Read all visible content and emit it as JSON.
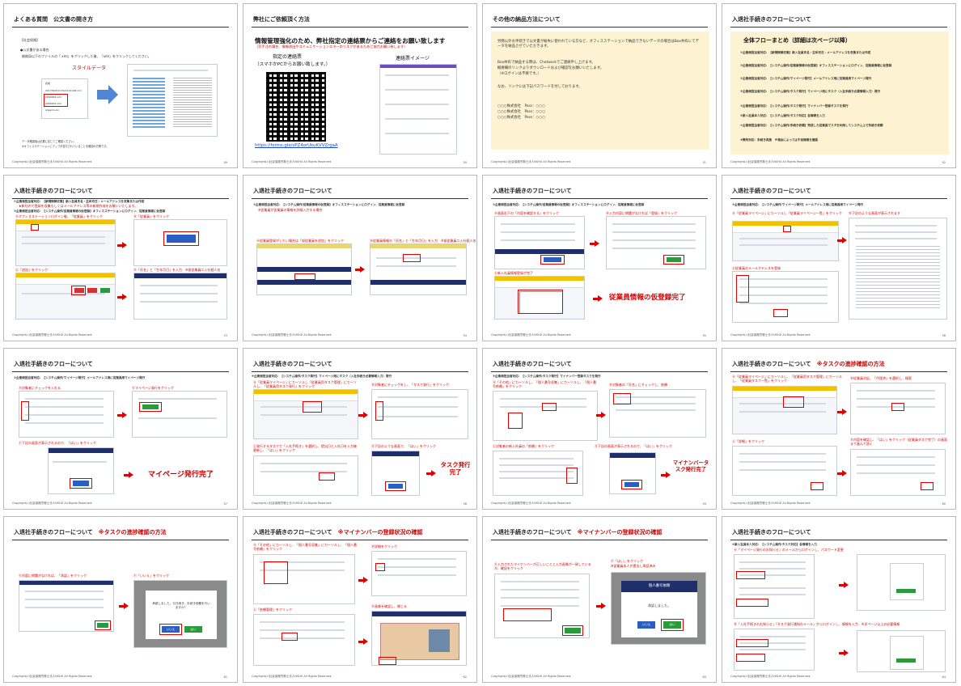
{
  "footer": "Copyright(c)社会保険労務士法人NSHU All Rights Reserved.",
  "slides": [
    {
      "title": "よくある質問　公文書の開き方",
      "num": "49"
    },
    {
      "title": "弊社にご依頼頂く方法",
      "num": "50"
    },
    {
      "title": "その他の納品方法について",
      "num": "51"
    },
    {
      "title": "入退社手続きのフローについて",
      "num": "52"
    },
    {
      "title": "入退社手続きのフローについて",
      "num": "53"
    },
    {
      "title": "入退社手続きのフローについて",
      "num": "54"
    },
    {
      "title": "入退社手続きのフローについて",
      "num": "55"
    },
    {
      "title": "入退社手続きのフローについて",
      "num": "56"
    },
    {
      "title": "入退社手続きのフローについて",
      "num": "57"
    },
    {
      "title": "入退社手続きのフローについて",
      "num": "58"
    },
    {
      "title": "入退社手続きのフローについて",
      "num": "59"
    },
    {
      "title": "入退社手続きのフローについて",
      "title_red": "※タスクの進捗確認の方法",
      "num": "60"
    },
    {
      "title": "入退社手続きのフローについて",
      "title_red": "※タスクの進捗確認の方法",
      "num": "61"
    },
    {
      "title": "入退社手続きのフローについて",
      "title_red": "※マイナンバーの登録状況の確認",
      "num": "62"
    },
    {
      "title": "入退社手続きのフローについて",
      "title_red": "※マイナンバーの登録状況の確認",
      "num": "63"
    },
    {
      "title": "入退社手続きのフローについて",
      "num": "64"
    }
  ],
  "s49": {
    "case": "【社会保険】",
    "bullet": "●公文書がある場合",
    "instr": "総務局以下のファイルの「.xml」をクリックした後、「xml」をクリックしてください。",
    "style_label": "スタイルデータ",
    "files": [
      "名前",
      "20170905111522112148.xml",
      "2064000.xml",
      "2064002.xml",
      "shgams.xsl"
    ],
    "note1": "データ確認後は必要に応じてご確認ください。",
    "note2": "※オフィスステーションにアップが並行されていることを確認の方策です。"
  },
  "s50": {
    "head": "情報管理強化のため、弊社指定の連絡票からご連絡をお願い致します",
    "sub": "（売手注の場合、情報流出やコミュニケーションエラーのリスクがあるためご協力お願い致します）",
    "form_label": "指定の連絡票",
    "form_note": "（スマホかPCからお願い致します。）",
    "image_label": "連絡票イメージ",
    "url": "https://forms.gle/sPZ4orUkuKVVZrgaA"
  },
  "s51": {
    "p1": "労務以外お手続きで公文書が紛失に使われている方など、オフィスステーションで納品できないデータの場合はBox共有にてデータを納品させていただきます。",
    "p2": "Box共有で納品する際は、Chatworkでご連絡申し上げます。",
    "p3": "概要欄のリンクよりダウンロードおよび確認をお願いいたします。",
    "p4": "（※ログインは不要です。）",
    "p5": "なお、リンクには下記パスワードを付しております。",
    "pw": [
      "○○○株式会社　Pass：○○○",
      "○○○株式会社　Pass：○○○",
      "○○○株式会社　Pass：○○○"
    ]
  },
  "s52": {
    "heading": "全体フローまとめ（詳細は次ページ以降）",
    "steps": [
      "①企業側担当者対応：【新規情報収集】新入社員氏名・生年月日・メールアドレスを収集または作成",
      "②企業側担当者対応：【システム操作/従業員情報の仮登録】オフィスステーションにログイン、従業員情報に仮登録",
      "③企業側担当者対応：【システム操作/マイページ発行】メールアドレス用に従業員用マイページ発行",
      "④企業側担当者対応：【システム操作/タスク発行】マイページ用にタスク（入社手続き必要情報入力）発行",
      "⑤企業側担当者対応：【システム操作/タスク発行】マイナンバー登録タスクを発行",
      "⑥新入社員本人対応：【システム操作/タスク対応】各情報を入力",
      "⑦企業側担当者対応：【システム操作/手続き依頼】完成した従業員マスタを利用してシステム上で手続き依頼",
      "⑧弊所対応：手続き実施　※場合によっては不足情報を確認"
    ]
  },
  "s53": {
    "l1": "①企業側担当者対応：【新規情報収集】新入社員氏名・生年月日・メールアドレスを収集または作成",
    "l2": "★新社内で登録を収集もしくはメールアドレス等の新規作成をお願いいたします。",
    "l3": "②企業側担当者対応：【システム操作/従業員情報の仮登録】オフィスステーションにログイン、従業員情報に仮登録",
    "a": "Ⓐオフィスステーションログイン後、「従業員」をクリック",
    "b": "Ⓑ「従業員」をクリック",
    "c": "Ⓒ「追加」をクリック",
    "d": "Ⓓ「氏名」と「生年月日」を入力　※仮従業員二入社個人名"
  },
  "s54": {
    "l1": "②企業側担当者対応：【システム操作/従業員情報の仮登録】オフィスステーションにログイン、従業員情報に仮登録",
    "l2": "※従業員が従業員の情報を詳細入力する場合",
    "a": "Ⓐ従業員登録がしたい場合は「仮従業員を追加」をクリック",
    "b": "Ⓑ従業員情報の「氏名」と「生年月日」を入力　※仮従業員二入社個人名"
  },
  "s55": {
    "l1": "②企業側担当者対応：【システム操作/従業員情報の仮登録】オフィスステーションにログイン、従業員情報に仮登録",
    "a": "Ⓐ画面右下の「内容を確認する」をクリック",
    "b": "Ⓑ入力内容に問題がなければ「登録」をクリック",
    "c": "Ⓒ新入社員情報登録が完了",
    "done": "従業員情報の仮登録完了"
  },
  "s56": {
    "l1": "③企業側担当者対応：【システム操作/マイページ発行】メールアドレス用に従業員用マイページ発行",
    "a": "Ⓐ「従業員マイページ」にカーソルし「従業員マイページ一覧」をクリック",
    "b": "Ⓑ下記のような画面が表示されます",
    "c": "Ⓒ従業員のメールアドレスを登録"
  },
  "s57": {
    "l1": "③企業側担当者対応：【システム操作/マイページ発行】メールアドレス用に従業員用マイページ発行",
    "a": "Ⓓ対象者にチェックを入れる",
    "b": "Ⓔマイページ発行をクリック",
    "c": "Ⓕ下記の画面が表示されるので、「はい」をクリック",
    "done": "マイページ発行完了"
  },
  "s58": {
    "l1": "④企業側担当者対応：【システム操作/タスク発行】マイページ用にタスク（入社手続き必要情報入力）発行",
    "a": "Ⓐ「従業員マイページ」にカーソルし「従業員用タスク管理」にカーソルし、「従業員用タスク発行」をクリック",
    "b": "Ⓑ対象者にチェックをし、「タスク発行」をクリック",
    "c": "Ⓒ発行するタスクで「入社手続き」を選択し、提出日と入社日を入力後更新し、「はい」をクリック",
    "d": "Ⓓ下記のような画面で、「はい」をクリック",
    "done": "タスク発行完了"
  },
  "s59": {
    "l1": "⑤企業側担当者対応：【システム操作/タスク発行】マイナンバー登録タスクを発行",
    "a": "Ⓐ「その他」にカーソルし、「個人番号収集」にカーソルし、「個人番号依頼」をクリック",
    "b": "Ⓑ対象者の「氏名」にチェックし、依頼",
    "c": "Ⓒ対象者の新入社員の「依頼」をクリック",
    "d": "Ⓓ下記の画面が表示されるので、「はい」をクリック",
    "done": "マイナンバータスク発行完了"
  },
  "s60": {
    "a": "Ⓐ「従業員マイページ」にカーソルし、「従業員用タスク管理」にカーソルし、「従業員タスク一覧」をクリック",
    "b": "Ⓑ従業員対応、「代理済」を選択し、検索",
    "c": "Ⓒ「詳細」をクリック",
    "d": "Ⓓ内容を確認し、「はい」をクリック（従業員タスク完了）の画面まで進んで頂く"
  },
  "s61": {
    "a": "Ⓔ内容に問題がなければ、「承認」をクリック",
    "b": "Ⓕ「いいえ」をクリック",
    "dlg": "承認しました。引き続き、手続き依頼を行いますか？",
    "no": "いいえ",
    "yes": "はい"
  },
  "s62": {
    "a": "Ⓐ「その他」にカーソルし、「個人番号収集」にカーソルし、「個人番号依頼」をクリック",
    "b": "Ⓑ詳細をクリック",
    "c": "Ⓒ「依頼管理」をクリック",
    "d": "Ⓓ画像を確認し、閉じる"
  },
  "s63": {
    "a": "Ⓔ入力されたマイナンバーが正しいことと入力画像が一致しているか、確認をクリック",
    "b": "Ⓕ「はい」をクリック",
    "b2": "※従業員本人が提出し承認済み",
    "dlg": "個人番号依頼",
    "dlg2": "承認しました。",
    "no": "いいえ",
    "yes": "はい"
  },
  "s64": {
    "l1": "⑥新入社員本人対応：【システム操作/タスク対応】各情報を入力",
    "a": "Ⓐ「マイページ発行のお知らせ」のメールからログインし、パスワード変更",
    "b": "Ⓑ「入社手続きのお知らせ」「タスク発行通知のメール」からログインし、情報を入力　※次ページ以上の必要情報"
  }
}
